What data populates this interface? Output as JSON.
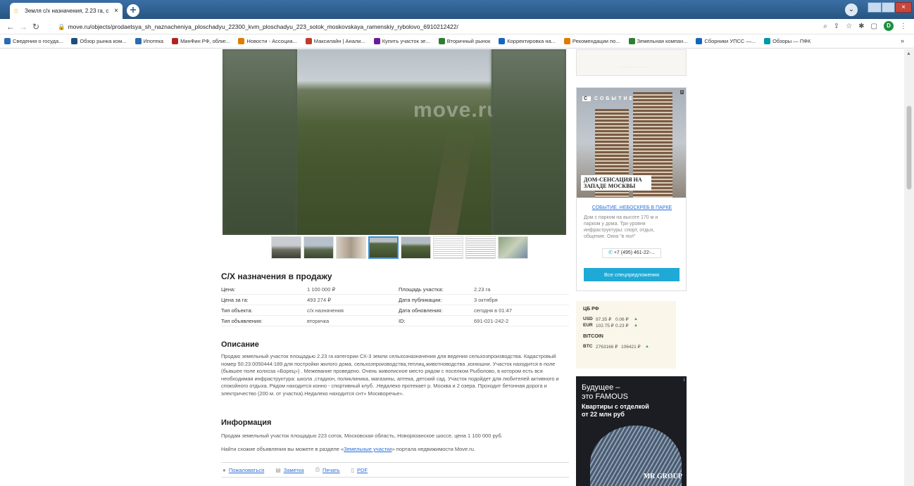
{
  "browser": {
    "tab_title": "Земля с/х назначения, 2.23 га, с",
    "url": "move.ru/objects/prodaetsya_sh_naznacheniya_ploschadyu_22300_kvm_ploschadyu_223_sotok_moskovskaya_ramenskiy_rybolovo_6910212422/",
    "profile_letter": "D",
    "bookmarks": [
      {
        "label": "Сведения о госуда...",
        "color": "#2b6cb0"
      },
      {
        "label": "Обзор рынка ком...",
        "color": "#1f4e79"
      },
      {
        "label": "Ипотека",
        "color": "#2b6cb0"
      },
      {
        "label": "МинФин РФ, облиг...",
        "color": "#b22222"
      },
      {
        "label": "Новости - Ассоциа...",
        "color": "#e07b00"
      },
      {
        "label": "Максилайн | Анали...",
        "color": "#c0392b"
      },
      {
        "label": "Купить участок зе...",
        "color": "#6a1b9a"
      },
      {
        "label": "Вторичный рынок",
        "color": "#2e7d32"
      },
      {
        "label": "Корректировка на...",
        "color": "#1565c0"
      },
      {
        "label": "Рекомендации по...",
        "color": "#e07b00"
      },
      {
        "label": "Земельная компан...",
        "color": "#2e7d32"
      },
      {
        "label": "Сборники УПСС —...",
        "color": "#1565c0"
      },
      {
        "label": "Обзоры — ПФК",
        "color": "#0097a7"
      }
    ],
    "bookmarks_more": "»"
  },
  "listing": {
    "photo_watermark": "move.ru",
    "title": "С/Х назначения в продажу",
    "properties": [
      {
        "label1": "Цена:",
        "value1": "1 100 000 ₽",
        "label2": "Площадь участка:",
        "value2": "2.23 га"
      },
      {
        "label1": "Цена за га:",
        "value1": "493 274 ₽",
        "label2": "Дата публикации:",
        "value2": "3 октября"
      },
      {
        "label1": "Тип объекта:",
        "value1": "с/х назначения",
        "label2": "Дата обновления:",
        "value2": "сегодня в 01:47"
      },
      {
        "label1": "Тип объявления:",
        "value1": "вторичка",
        "label2": "ID:",
        "value2": "691-021-242-2"
      }
    ],
    "description_heading": "Описание",
    "description": "Продаю земельный участок площадью 2.23 га категории СХ-3 земли сельхозназначения для ведения сельхозпроизводства. Кадастровый номер 50:23:0050444:189 для постройки жилого дома, сельхозпроизводства,теплиц,животноводства ,конюшни. Участок находится в поле (бывшее поле колхоза «Борец») . Межевание проведено. Очень живописное место рядом с поселком Рыболово, в котором есть вся необходимая инфраструктура: школа ,стадион, поликлиника, магазины, аптека, детский сад. Участок подойдет для любителей активного и спокойного отдыха. Рядом находится конно - спортивный клуб. .Недалеко протекает р. Москва и 2 озера. Проходит бетонная дорога и электричество (200 м. от участка).Недалеко находится снт» Москворечье».",
    "info_heading": "Информация",
    "info_line1": "Продам земельный участок площадью 223 соток, Московская область, Новорязанское шоссе, цена 1 100 000 руб.",
    "info_line2_prefix": "Найти схожие объявления вы можете в разделе «",
    "info_line2_link": "Земельные участки",
    "info_line2_suffix": "» портала недвижимости Move.ru.",
    "actions": {
      "complain": "Пожаловаться",
      "note": "Заметка",
      "print": "Печать",
      "pdf": "PDF"
    }
  },
  "sidebar": {
    "event_ad": {
      "brand": "СОБЫТИЕ",
      "headline": "ДОМ-СЕНСАЦИЯ НА ЗАПАДЕ МОСКВЫ",
      "link": "СОБЫТИЕ. НЕБОСКРЕБ В ПАРКЕ",
      "text": "Дом с парком на высоте 170 м и парком у дома. Три уровня инфраструктуры: спорт, отдых, общение. Окна \"в пол\"",
      "phone": "+7 (495) 461-22-...",
      "button": "Все спецпредложения",
      "info": "i"
    },
    "rates": {
      "heading": "ЦБ РФ",
      "items": [
        {
          "code": "USD",
          "value": "97.35 ₽",
          "delta": "0.06 ₽"
        },
        {
          "code": "EUR",
          "value": "102.75 ₽",
          "delta": "0.23 ₽"
        }
      ],
      "btc_heading": "BITCOIN",
      "btc": {
        "code": "BTC",
        "value": "2763166 ₽",
        "delta": "106421 ₽"
      }
    },
    "famous_ad": {
      "line1": "Будущее –",
      "line2": "это FAMOUS",
      "line3": "Квартиры с отделкой",
      "line4": "от 22 млн руб",
      "brand": "MR GROUP",
      "info": "i"
    }
  },
  "colors": {
    "link": "#2a6fd6",
    "button": "#1fa9d6",
    "rate_up": "#39a845"
  }
}
